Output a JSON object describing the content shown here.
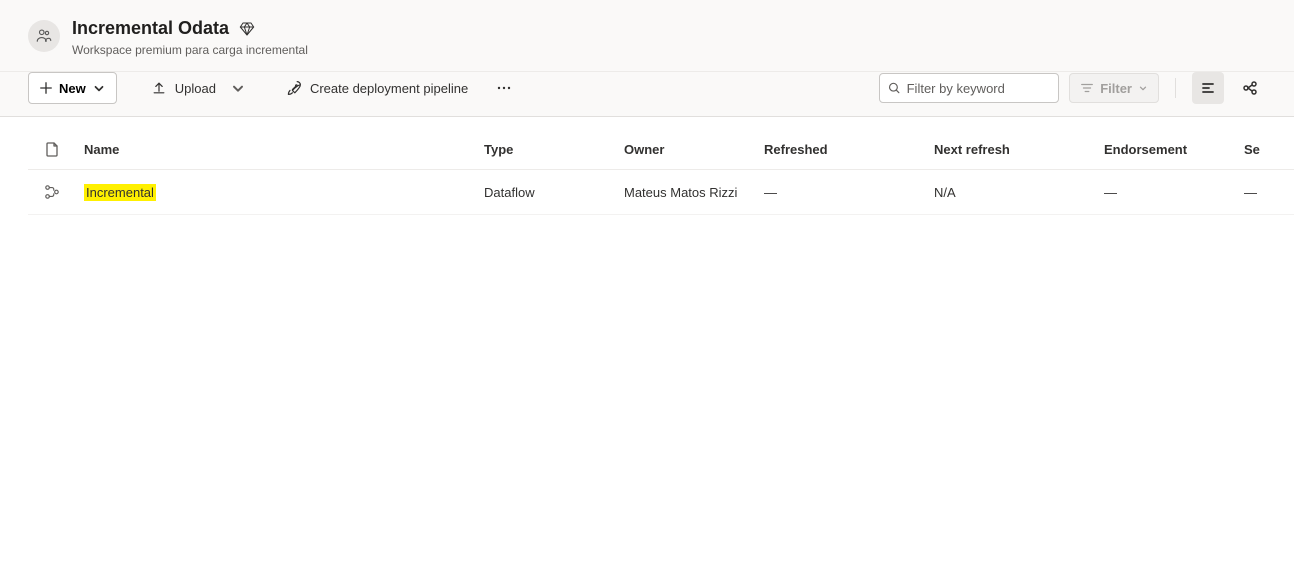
{
  "workspace": {
    "title": "Incremental Odata",
    "subtitle": "Workspace premium para carga incremental"
  },
  "toolbar": {
    "new_label": "New",
    "upload_label": "Upload",
    "pipeline_label": "Create deployment pipeline",
    "search_placeholder": "Filter by keyword",
    "filter_label": "Filter"
  },
  "columns": {
    "name": "Name",
    "type": "Type",
    "owner": "Owner",
    "refreshed": "Refreshed",
    "next_refresh": "Next refresh",
    "endorsement": "Endorsement",
    "sensitivity": "Se"
  },
  "rows": [
    {
      "name": "Incremental",
      "name_highlighted": true,
      "type": "Dataflow",
      "owner": "Mateus Matos Rizzi",
      "refreshed": "—",
      "next_refresh": "N/A",
      "endorsement": "—",
      "sensitivity": "—"
    }
  ]
}
